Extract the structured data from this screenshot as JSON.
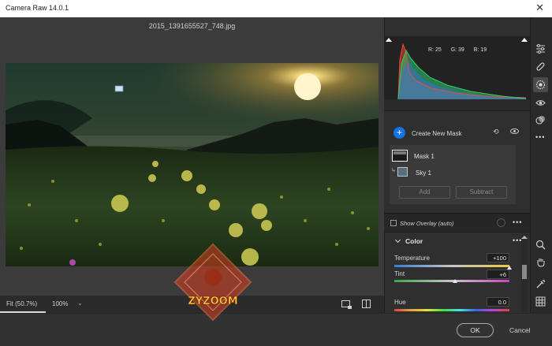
{
  "window": {
    "title": "Camera Raw 14.0.1",
    "close_glyph": "✕"
  },
  "file": {
    "name": "2015_1391655527_748.jpg"
  },
  "histogram": {
    "r_label": "R: 25",
    "g_label": "G: 39",
    "b_label": "B: 19"
  },
  "masking": {
    "create_label": "Create New Mask",
    "masks": [
      {
        "label": "Mask 1"
      },
      {
        "label": "Sky 1"
      }
    ],
    "add_label": "Add",
    "subtract_label": "Subtract",
    "overlay_label": "Show Overlay (auto)"
  },
  "color_section": {
    "title": "Color",
    "sliders": [
      {
        "label": "Temperature",
        "value": "+100",
        "level": 1.0
      },
      {
        "label": "Tint",
        "value": "+6",
        "level": 0.53
      },
      {
        "label": "Hue",
        "value": "0.0",
        "level": 0.5
      }
    ]
  },
  "zoom": {
    "fit_label": "Fit (50.7%)",
    "zoom_label": "100%"
  },
  "footer": {
    "ok_label": "OK",
    "cancel_label": "Cancel"
  },
  "watermark": {
    "text": "ZYZOOM"
  },
  "icons": {
    "gear": "gear-icon",
    "expand": "expand-icon",
    "edit": "sliders-icon",
    "heal": "bandage-icon",
    "mask": "mask-icon",
    "redeye": "eye-icon",
    "presets": "presets-icon",
    "more": "more-icon",
    "zoom": "zoom-icon",
    "hand": "hand-icon",
    "sampler": "eyedropper-icon",
    "grid": "grid-icon"
  },
  "colors": {
    "accent": "#1473e6",
    "panel": "#2f2f2f",
    "background": "#323232"
  }
}
